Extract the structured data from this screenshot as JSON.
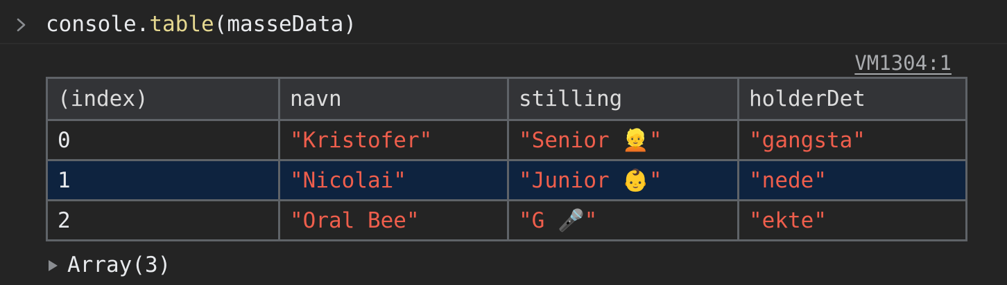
{
  "console": {
    "input": {
      "object": "console",
      "dot": ".",
      "method": "table",
      "open_paren": "(",
      "argument": "masseData",
      "close_paren": ")"
    },
    "source_link": "VM1304:1",
    "table": {
      "columns": [
        "(index)",
        "navn",
        "stilling",
        "holderDet"
      ],
      "rows": [
        {
          "index": "0",
          "navn": "\"Kristofer\"",
          "stilling": "\"Senior 👱\"",
          "holderDet": "\"gangsta\""
        },
        {
          "index": "1",
          "navn": "\"Nicolai\"",
          "stilling": "\"Junior 👶\"",
          "holderDet": "\"nede\""
        },
        {
          "index": "2",
          "navn": "\"Oral Bee\"",
          "stilling": "\"G 🎤\"",
          "holderDet": "\"ekte\""
        }
      ],
      "selected_row": 1
    },
    "array_summary": "Array(3)"
  },
  "icons": {
    "prompt": "chevron-right-icon",
    "expand": "triangle-right-icon"
  },
  "colors": {
    "background": "#242424",
    "string": "#ef5e4c",
    "method": "#e5d890",
    "selected_row": "#0e233f",
    "header_bg": "#333437",
    "grid": "#5f6368"
  }
}
